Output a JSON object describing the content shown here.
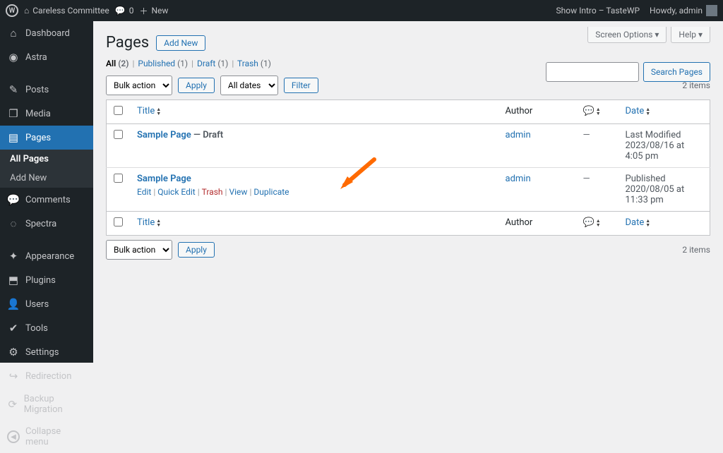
{
  "adminbar": {
    "site_name": "Careless Committee",
    "comment_count": "0",
    "new_label": "New",
    "show_intro": "Show Intro – TasteWP",
    "howdy": "Howdy, admin"
  },
  "sidebar": {
    "items": [
      {
        "label": "Dashboard",
        "icon": "⌂"
      },
      {
        "label": "Astra",
        "icon": "◉"
      },
      {
        "label": "Posts",
        "icon": "✎"
      },
      {
        "label": "Media",
        "icon": "❐"
      },
      {
        "label": "Pages",
        "icon": "▤",
        "active": true
      },
      {
        "label": "Comments",
        "icon": "💬"
      },
      {
        "label": "Spectra",
        "icon": "◌"
      },
      {
        "label": "Appearance",
        "icon": "✦"
      },
      {
        "label": "Plugins",
        "icon": "⬒"
      },
      {
        "label": "Users",
        "icon": "👤"
      },
      {
        "label": "Tools",
        "icon": "✔"
      },
      {
        "label": "Settings",
        "icon": "⚙"
      },
      {
        "label": "Redirection",
        "icon": "↪"
      },
      {
        "label": "Backup Migration",
        "icon": "⟳"
      }
    ],
    "submenu": {
      "all_pages": "All Pages",
      "add_new": "Add New"
    },
    "collapse": "Collapse menu"
  },
  "page": {
    "title": "Pages",
    "add_new": "Add New",
    "screen_options": "Screen Options ▾",
    "help": "Help ▾",
    "items_count": "2 items",
    "search_button": "Search Pages"
  },
  "views": {
    "all_label": "All",
    "all_count": "(2)",
    "published_label": "Published",
    "published_count": "(1)",
    "draft_label": "Draft",
    "draft_count": "(1)",
    "trash_label": "Trash",
    "trash_count": "(1)"
  },
  "controls": {
    "bulk_actions": "Bulk actions",
    "apply": "Apply",
    "all_dates": "All dates",
    "filter": "Filter"
  },
  "columns": {
    "title": "Title",
    "author": "Author",
    "date": "Date"
  },
  "rows": [
    {
      "title": "Sample Page",
      "state": " — Draft",
      "author": "admin",
      "comments": "—",
      "date_status": "Last Modified",
      "date_value": "2023/08/16 at 4:05 pm",
      "show_actions": false
    },
    {
      "title": "Sample Page",
      "state": "",
      "author": "admin",
      "comments": "—",
      "date_status": "Published",
      "date_value": "2020/08/05 at 11:33 pm",
      "show_actions": true
    }
  ],
  "row_actions": {
    "edit": "Edit",
    "quick_edit": "Quick Edit",
    "trash": "Trash",
    "view": "View",
    "duplicate": "Duplicate"
  }
}
